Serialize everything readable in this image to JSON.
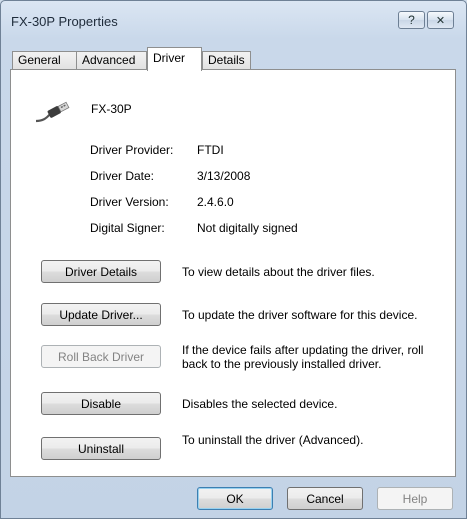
{
  "window": {
    "title": "FX-30P Properties",
    "help_glyph": "?",
    "close_glyph": "✕"
  },
  "tabs": [
    {
      "label": "General"
    },
    {
      "label": "Advanced"
    },
    {
      "label": "Driver"
    },
    {
      "label": "Details"
    }
  ],
  "device": {
    "name": "FX-30P",
    "icon": "usb-cable-icon"
  },
  "properties": [
    {
      "label": "Driver Provider:",
      "value": "FTDI"
    },
    {
      "label": "Driver Date:",
      "value": "3/13/2008"
    },
    {
      "label": "Driver Version:",
      "value": "2.4.6.0"
    },
    {
      "label": "Digital Signer:",
      "value": "Not digitally signed"
    }
  ],
  "actions": [
    {
      "label": "Driver Details",
      "description": "To view details about the driver files."
    },
    {
      "label": "Update Driver...",
      "description": "To update the driver software for this device."
    },
    {
      "label": "Roll Back Driver",
      "description": "If the device fails after updating the driver, roll back to the previously installed driver."
    },
    {
      "label": "Disable",
      "description": "Disables the selected device."
    },
    {
      "label": "Uninstall",
      "description": "To uninstall the driver (Advanced)."
    }
  ],
  "footer": {
    "ok": "OK",
    "cancel": "Cancel",
    "help": "Help"
  }
}
